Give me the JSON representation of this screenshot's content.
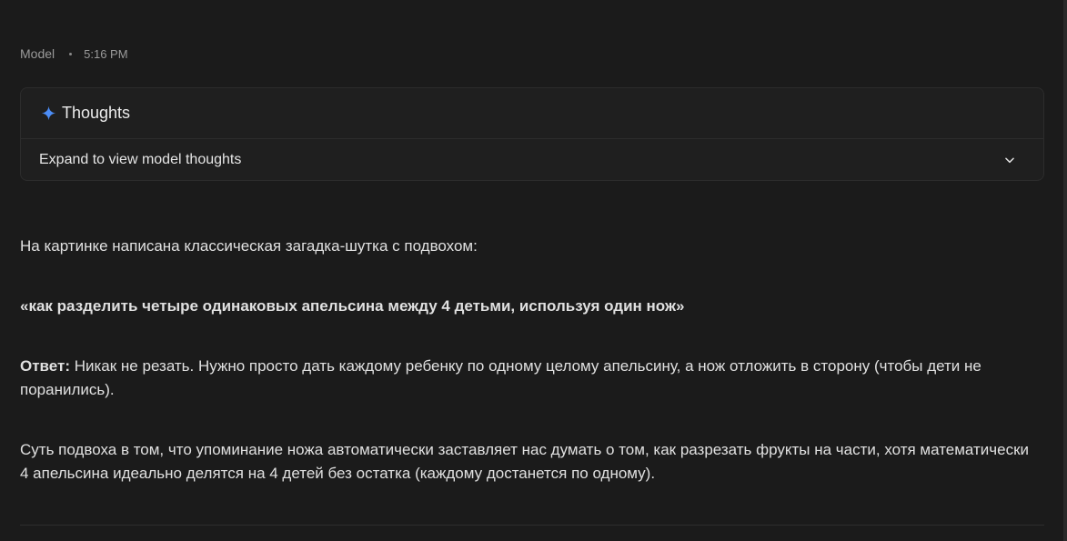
{
  "message": {
    "author": "Model",
    "time": "5:16 PM"
  },
  "thoughts": {
    "title": "Thoughts",
    "expand_label": "Expand to view model thoughts",
    "icon": "sparkle-icon",
    "accent": "#4c8df6"
  },
  "response": {
    "intro": "На картинке написана классическая загадка-шутка с подвохом:",
    "riddle": "«как разделить четыре одинаковых апельсина между 4 детьми, используя один нож»",
    "answer_label": "Ответ:",
    "answer_text": " Никак не резать. Нужно просто дать каждому ребенку по одному целому апельсину, а нож отложить в сторону (чтобы дети не поранились).",
    "explanation": "Суть подвоха в том, что упоминание ножа автоматически заставляет нас думать о том, как разрезать фрукты на части, хотя математически 4 апельсина идеально делятся на 4 детей без остатка (каждому достанется по одному)."
  }
}
